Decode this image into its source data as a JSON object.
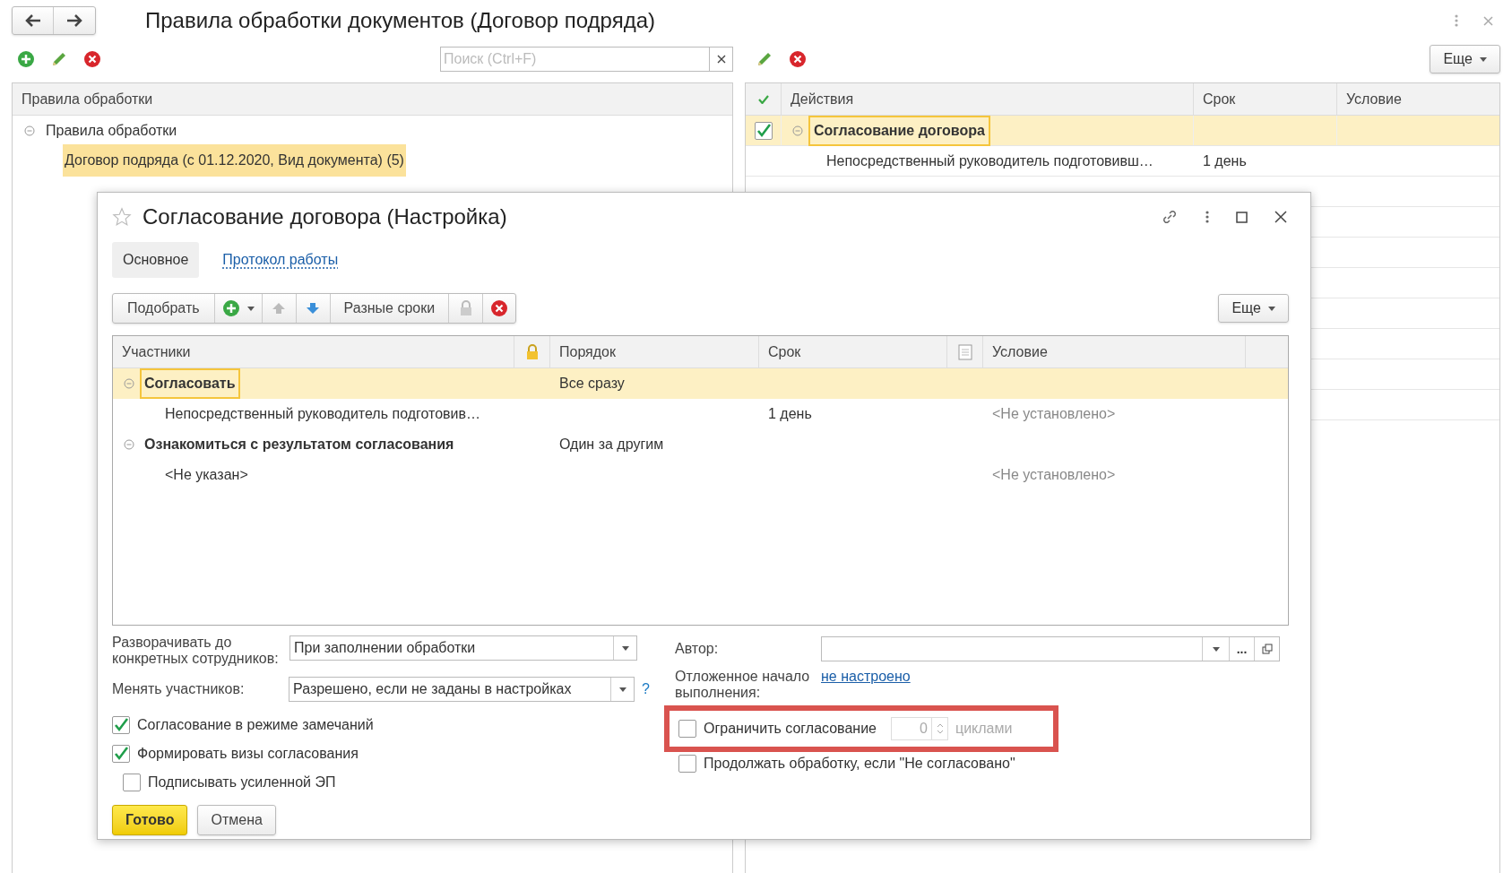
{
  "window": {
    "title": "Правила обработки документов (Договор подряда)"
  },
  "left_panel": {
    "search": {
      "placeholder": "Поиск (Ctrl+F)"
    },
    "column": "Правила обработки",
    "tree": [
      {
        "label": "Правила обработки",
        "expanded": true,
        "selected": false,
        "children": [
          {
            "label": "Договор подряда (с 01.12.2020, Вид документа) (5)",
            "selected": true
          }
        ]
      }
    ]
  },
  "right_panel": {
    "more_button": "Еще",
    "columns": [
      "Действия",
      "Срок",
      "Условие"
    ],
    "rows": [
      {
        "checked": true,
        "expanded": true,
        "selected": true,
        "label": "Согласование договора",
        "children": [
          {
            "label": "Непосредственный руководитель подготовивш…",
            "term": "1 день"
          }
        ]
      }
    ]
  },
  "dialog": {
    "title": "Согласование договора (Настройка)",
    "tabs": [
      {
        "label": "Основное",
        "selected": true
      },
      {
        "label": "Протокол работы",
        "selected": false
      }
    ],
    "toolbar": {
      "pick_button": "Подобрать",
      "terms_button": "Разные сроки",
      "more_button": "Еще"
    },
    "table": {
      "columns": [
        "Участники",
        "Порядок",
        "Срок",
        "Условие"
      ],
      "rows": [
        {
          "label": "Согласовать",
          "order": "Все сразу",
          "expanded": true,
          "selected": true,
          "children": [
            {
              "label": "Непосредственный руководитель подготовив…",
              "term": "1 день",
              "condition": "<Не установлено>"
            }
          ]
        },
        {
          "label": "Ознакомиться с результатом согласования",
          "order": "Один за другим",
          "expanded": true,
          "selected": false,
          "children": [
            {
              "label": "<Не указан>",
              "condition": "<Не установлено>"
            }
          ]
        }
      ]
    },
    "fields": {
      "expand": {
        "label": "Разворачивать до конкретных сотрудников:",
        "value": "При заполнении обработки"
      },
      "change": {
        "label": "Менять участников:",
        "value": "Разрешено, если не заданы в настройках",
        "help": "?"
      },
      "author": {
        "label": "Автор:",
        "more": "..."
      },
      "deferred": {
        "label": "Отложенное начало выполнения:",
        "link": "не настроено"
      }
    },
    "checkboxes": [
      {
        "label": "Согласование в режиме замечаний",
        "checked": true
      },
      {
        "label": "Формировать визы согласования",
        "checked": true
      },
      {
        "label": "Подписывать усиленной ЭП",
        "checked": false
      }
    ],
    "limit": {
      "label": "Ограничить согласование",
      "checked": false,
      "count": "0",
      "unit": "циклами",
      "highlighted": true
    },
    "continue": {
      "label": "Продолжать обработку, если \"Не согласовано\"",
      "checked": false
    },
    "buttons": [
      {
        "label": "Готово",
        "kind": "primary"
      },
      {
        "label": "Отмена",
        "kind": "default"
      }
    ]
  }
}
